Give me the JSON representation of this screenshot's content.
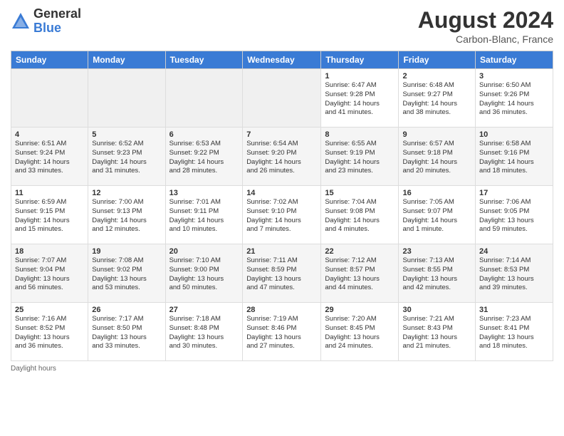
{
  "header": {
    "logo_general": "General",
    "logo_blue": "Blue",
    "month_title": "August 2024",
    "location": "Carbon-Blanc, France"
  },
  "weekdays": [
    "Sunday",
    "Monday",
    "Tuesday",
    "Wednesday",
    "Thursday",
    "Friday",
    "Saturday"
  ],
  "weeks": [
    {
      "days": [
        {
          "num": "",
          "info": ""
        },
        {
          "num": "",
          "info": ""
        },
        {
          "num": "",
          "info": ""
        },
        {
          "num": "",
          "info": ""
        },
        {
          "num": "1",
          "info": "Sunrise: 6:47 AM\nSunset: 9:28 PM\nDaylight: 14 hours\nand 41 minutes."
        },
        {
          "num": "2",
          "info": "Sunrise: 6:48 AM\nSunset: 9:27 PM\nDaylight: 14 hours\nand 38 minutes."
        },
        {
          "num": "3",
          "info": "Sunrise: 6:50 AM\nSunset: 9:26 PM\nDaylight: 14 hours\nand 36 minutes."
        }
      ]
    },
    {
      "days": [
        {
          "num": "4",
          "info": "Sunrise: 6:51 AM\nSunset: 9:24 PM\nDaylight: 14 hours\nand 33 minutes."
        },
        {
          "num": "5",
          "info": "Sunrise: 6:52 AM\nSunset: 9:23 PM\nDaylight: 14 hours\nand 31 minutes."
        },
        {
          "num": "6",
          "info": "Sunrise: 6:53 AM\nSunset: 9:22 PM\nDaylight: 14 hours\nand 28 minutes."
        },
        {
          "num": "7",
          "info": "Sunrise: 6:54 AM\nSunset: 9:20 PM\nDaylight: 14 hours\nand 26 minutes."
        },
        {
          "num": "8",
          "info": "Sunrise: 6:55 AM\nSunset: 9:19 PM\nDaylight: 14 hours\nand 23 minutes."
        },
        {
          "num": "9",
          "info": "Sunrise: 6:57 AM\nSunset: 9:18 PM\nDaylight: 14 hours\nand 20 minutes."
        },
        {
          "num": "10",
          "info": "Sunrise: 6:58 AM\nSunset: 9:16 PM\nDaylight: 14 hours\nand 18 minutes."
        }
      ]
    },
    {
      "days": [
        {
          "num": "11",
          "info": "Sunrise: 6:59 AM\nSunset: 9:15 PM\nDaylight: 14 hours\nand 15 minutes."
        },
        {
          "num": "12",
          "info": "Sunrise: 7:00 AM\nSunset: 9:13 PM\nDaylight: 14 hours\nand 12 minutes."
        },
        {
          "num": "13",
          "info": "Sunrise: 7:01 AM\nSunset: 9:11 PM\nDaylight: 14 hours\nand 10 minutes."
        },
        {
          "num": "14",
          "info": "Sunrise: 7:02 AM\nSunset: 9:10 PM\nDaylight: 14 hours\nand 7 minutes."
        },
        {
          "num": "15",
          "info": "Sunrise: 7:04 AM\nSunset: 9:08 PM\nDaylight: 14 hours\nand 4 minutes."
        },
        {
          "num": "16",
          "info": "Sunrise: 7:05 AM\nSunset: 9:07 PM\nDaylight: 14 hours\nand 1 minute."
        },
        {
          "num": "17",
          "info": "Sunrise: 7:06 AM\nSunset: 9:05 PM\nDaylight: 13 hours\nand 59 minutes."
        }
      ]
    },
    {
      "days": [
        {
          "num": "18",
          "info": "Sunrise: 7:07 AM\nSunset: 9:04 PM\nDaylight: 13 hours\nand 56 minutes."
        },
        {
          "num": "19",
          "info": "Sunrise: 7:08 AM\nSunset: 9:02 PM\nDaylight: 13 hours\nand 53 minutes."
        },
        {
          "num": "20",
          "info": "Sunrise: 7:10 AM\nSunset: 9:00 PM\nDaylight: 13 hours\nand 50 minutes."
        },
        {
          "num": "21",
          "info": "Sunrise: 7:11 AM\nSunset: 8:59 PM\nDaylight: 13 hours\nand 47 minutes."
        },
        {
          "num": "22",
          "info": "Sunrise: 7:12 AM\nSunset: 8:57 PM\nDaylight: 13 hours\nand 44 minutes."
        },
        {
          "num": "23",
          "info": "Sunrise: 7:13 AM\nSunset: 8:55 PM\nDaylight: 13 hours\nand 42 minutes."
        },
        {
          "num": "24",
          "info": "Sunrise: 7:14 AM\nSunset: 8:53 PM\nDaylight: 13 hours\nand 39 minutes."
        }
      ]
    },
    {
      "days": [
        {
          "num": "25",
          "info": "Sunrise: 7:16 AM\nSunset: 8:52 PM\nDaylight: 13 hours\nand 36 minutes."
        },
        {
          "num": "26",
          "info": "Sunrise: 7:17 AM\nSunset: 8:50 PM\nDaylight: 13 hours\nand 33 minutes."
        },
        {
          "num": "27",
          "info": "Sunrise: 7:18 AM\nSunset: 8:48 PM\nDaylight: 13 hours\nand 30 minutes."
        },
        {
          "num": "28",
          "info": "Sunrise: 7:19 AM\nSunset: 8:46 PM\nDaylight: 13 hours\nand 27 minutes."
        },
        {
          "num": "29",
          "info": "Sunrise: 7:20 AM\nSunset: 8:45 PM\nDaylight: 13 hours\nand 24 minutes."
        },
        {
          "num": "30",
          "info": "Sunrise: 7:21 AM\nSunset: 8:43 PM\nDaylight: 13 hours\nand 21 minutes."
        },
        {
          "num": "31",
          "info": "Sunrise: 7:23 AM\nSunset: 8:41 PM\nDaylight: 13 hours\nand 18 minutes."
        }
      ]
    }
  ],
  "footer": {
    "daylight_label": "Daylight hours"
  }
}
